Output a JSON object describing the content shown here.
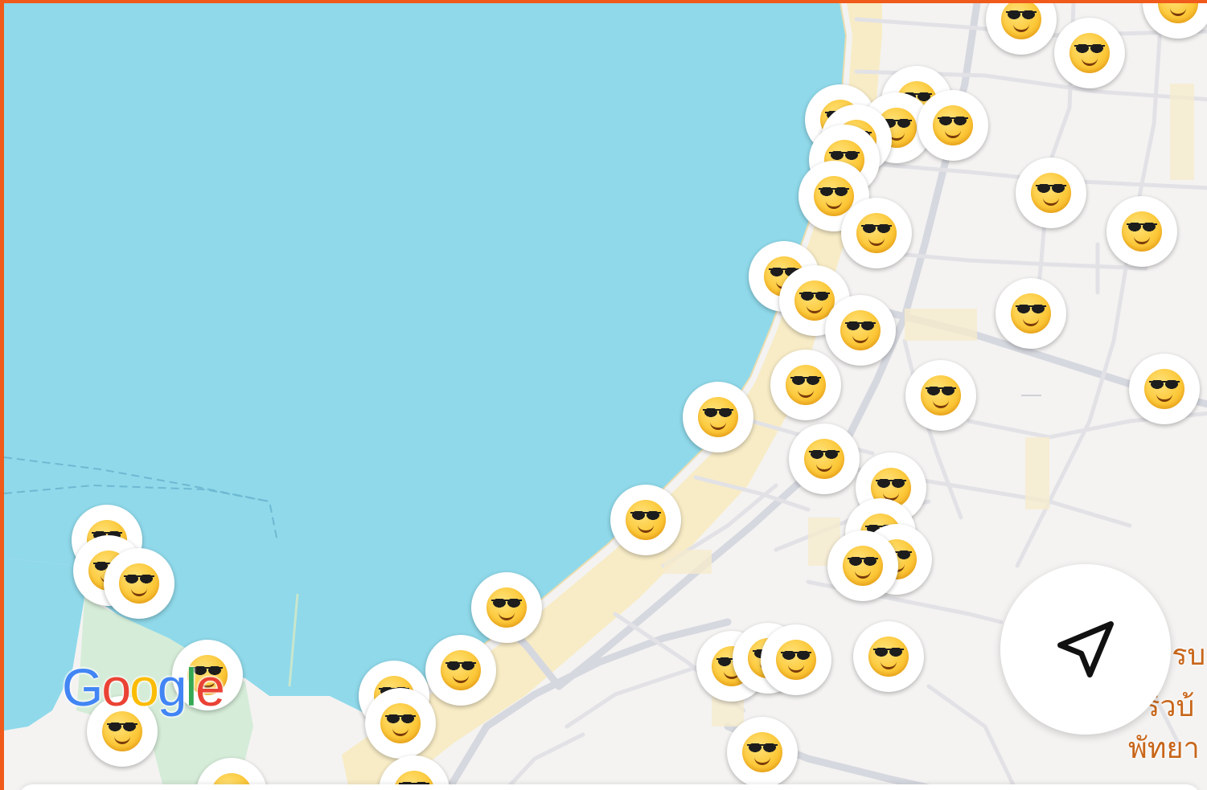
{
  "map": {
    "colors": {
      "water": "#8fd9ea",
      "land": "#f4f3f2",
      "road": "#dcdde3",
      "road_minor": "#e6e6ea",
      "beach": "#f8ecc6",
      "park": "#d5ecd8",
      "marker_bg": "#ffffff",
      "accent": "#f05a1a",
      "place_label": "#c8661a"
    },
    "marker_icon": "smiling-face-with-sunglasses-icon",
    "marker_count": 44,
    "place_labels": {
      "line1": "ครบ",
      "line2": "ร่วบ้",
      "line3": "พัทยา"
    }
  },
  "logo": {
    "letters": [
      {
        "char": "G",
        "color": "#4285f4"
      },
      {
        "char": "o",
        "color": "#ea4335"
      },
      {
        "char": "o",
        "color": "#fbbc05"
      },
      {
        "char": "g",
        "color": "#4285f4"
      },
      {
        "char": "l",
        "color": "#34a853"
      },
      {
        "char": "e",
        "color": "#ea4335"
      }
    ]
  },
  "controls": {
    "locate_icon": "navigation-arrow-icon"
  }
}
